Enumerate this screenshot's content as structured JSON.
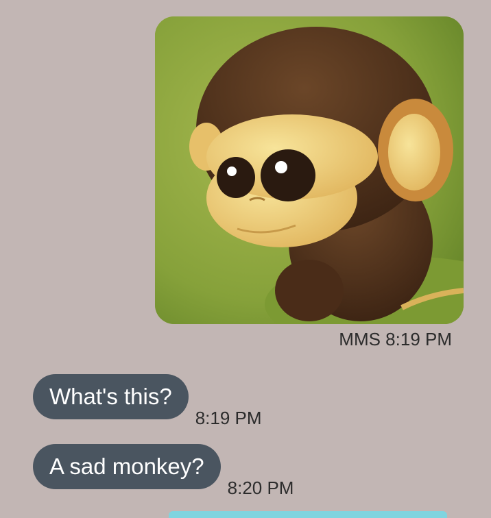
{
  "mms": {
    "image_subject": "sad-cartoon-monkey",
    "label": "MMS",
    "time": "8:19 PM"
  },
  "messages": [
    {
      "text": "What's this?",
      "time": "8:19 PM"
    },
    {
      "text": "A sad monkey?",
      "time": "8:20 PM"
    }
  ],
  "colors": {
    "background": "#c2b6b4",
    "bubble": "#4a5560",
    "bubble_text": "#ffffff",
    "meta_text": "#2c2c2c",
    "accent": "#7fd4df"
  }
}
